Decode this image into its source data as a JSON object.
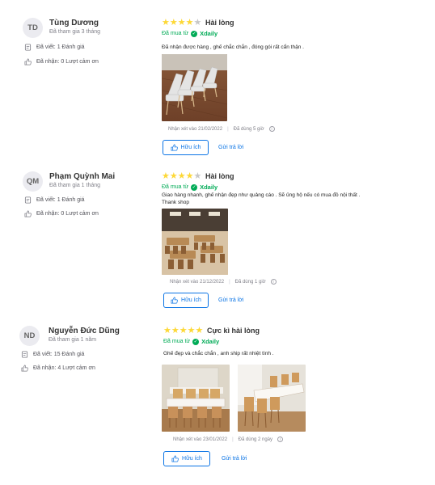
{
  "reviews": [
    {
      "avatar_initials": "TD",
      "name": "Tùng Dương",
      "joined": "Đã tham gia 3 tháng",
      "written_label": "Đã viết:",
      "written_value": "1 Đánh giá",
      "thanks_label": "Đã nhận:",
      "thanks_value": "0 Lượt cảm ơn",
      "rating": 4,
      "rating_title": "Hài lòng",
      "bought_prefix": "Đã mua từ",
      "seller": "Xdaily",
      "text": "Đã nhận được hàng , ghế chắc chắn , đóng gói rất cẩn thận .",
      "reviewed_on": "Nhận xét vào 21/02/2022",
      "used_for": "Đã dùng 5 giờ",
      "helpful_label": "Hữu ích",
      "reply_label": "Gửi trả lời"
    },
    {
      "avatar_initials": "QM",
      "name": "Phạm Quỳnh Mai",
      "joined": "Đã tham gia 1 tháng",
      "written_label": "Đã viết:",
      "written_value": "1 Đánh giá",
      "thanks_label": "Đã nhận:",
      "thanks_value": "0 Lượt cảm ơn",
      "rating": 4,
      "rating_title": "Hài lòng",
      "bought_prefix": "Đã mua từ",
      "seller": "Xdaily",
      "text": "Giao hàng nhanh, ghế nhận đẹp như quảng cáo . Sẽ ủng  hộ nếu có mua đồ nội thất . Thank shop",
      "reviewed_on": "Nhận xét vào 21/12/2022",
      "used_for": "Đã dùng 1 giờ",
      "helpful_label": "Hữu ích",
      "reply_label": "Gửi trả lời"
    },
    {
      "avatar_initials": "ND",
      "name": "Nguyễn Đức Dũng",
      "joined": "Đã tham gia 1 năm",
      "written_label": "Đã viết:",
      "written_value": "15 Đánh giá",
      "thanks_label": "Đã nhận:",
      "thanks_value": "4 Lượt cảm ơn",
      "rating": 5,
      "rating_title": "Cực kì hài lòng",
      "bought_prefix": "Đã mua từ",
      "seller": "Xdaily",
      "text": "Ghế đẹp và chắc chắn , anh ship rất nhiệt tình .",
      "reviewed_on": "Nhận xét vào 23/01/2022",
      "used_for": "Đã dùng 2 ngày",
      "helpful_label": "Hữu ích",
      "reply_label": "Gửi trả lời"
    }
  ],
  "colors": {
    "star": "#fdd836",
    "star_off": "#c7c7c7",
    "bought_green": "#00ab56",
    "link_blue": "#0b74e5"
  }
}
